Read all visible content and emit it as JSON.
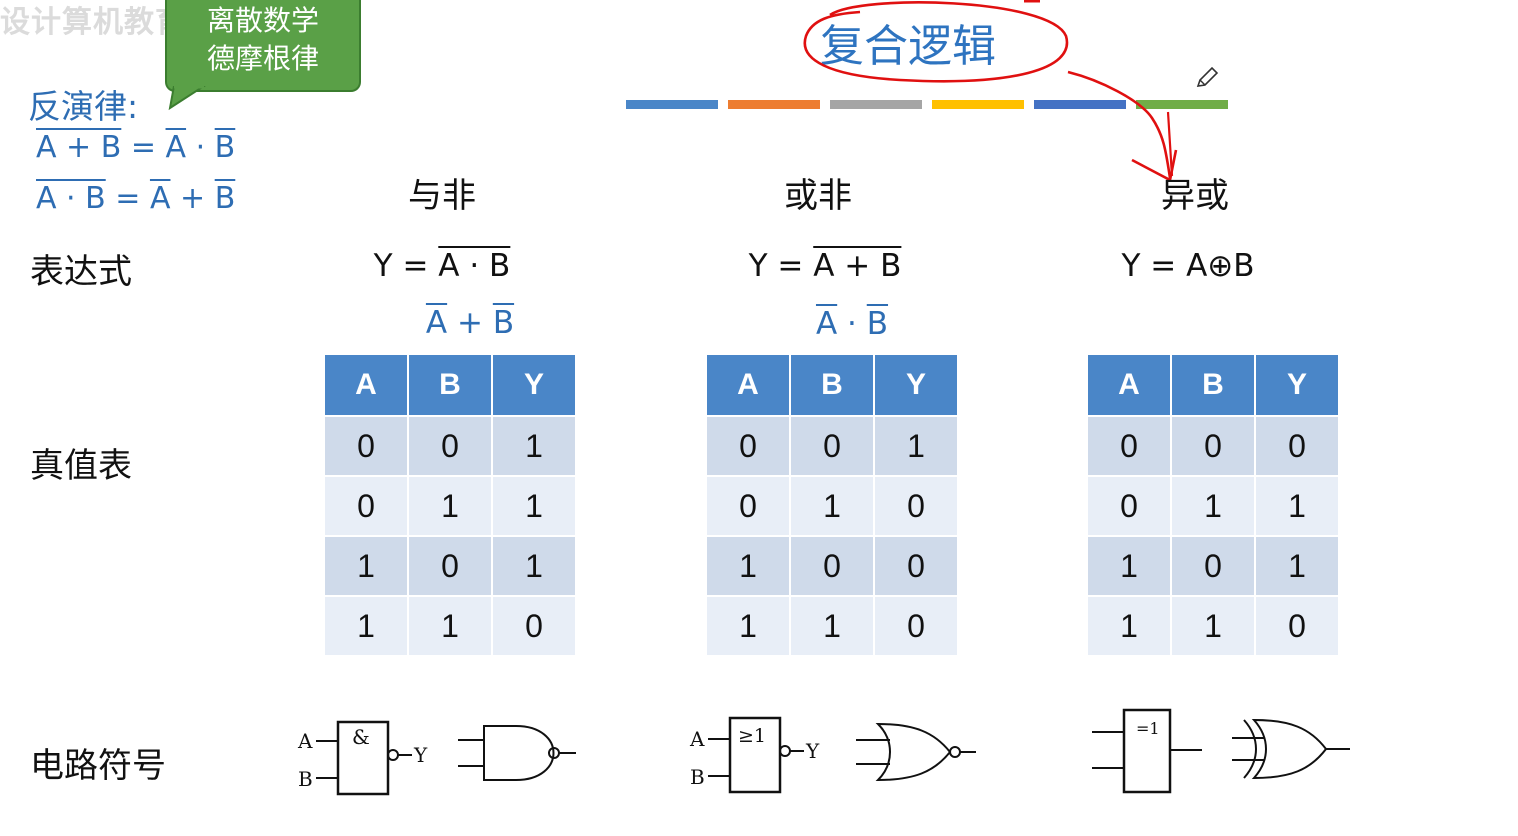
{
  "watermark": "设计算机教育",
  "callout": {
    "line1": "离散数学",
    "line2": "德摩根律"
  },
  "de_morgan": {
    "title": "反演律:",
    "law1": {
      "lhs": "A + B",
      "eq": " = ",
      "a": "A",
      "op": " · ",
      "b": "B"
    },
    "law2": {
      "lhs": "A · B",
      "eq": " = ",
      "a": "A",
      "op": " + ",
      "b": "B"
    }
  },
  "title": "复合逻辑",
  "color_bars": [
    "#4a86c8",
    "#ed7d31",
    "#a5a5a5",
    "#ffc000",
    "#4472c4",
    "#70ad47"
  ],
  "row_labels": {
    "expression": "表达式",
    "truth_table": "真值表",
    "symbol": "电路符号"
  },
  "columns": [
    {
      "name": "与非",
      "expr_prefix": "Y = ",
      "expr_bar": "A · B",
      "expr_plain": "",
      "alt": {
        "a": "A",
        "op": " + ",
        "b": "B"
      },
      "headers": [
        "A",
        "B",
        "Y"
      ],
      "rows": [
        [
          "0",
          "0",
          "1"
        ],
        [
          "0",
          "1",
          "1"
        ],
        [
          "1",
          "0",
          "1"
        ],
        [
          "1",
          "1",
          "0"
        ]
      ],
      "symbol_text": {
        "a": "A",
        "b": "B",
        "y": "Y",
        "gate": "&"
      }
    },
    {
      "name": "或非",
      "expr_prefix": "Y = ",
      "expr_bar": "A + B",
      "expr_plain": "",
      "alt": {
        "a": "A",
        "op": " · ",
        "b": "B"
      },
      "headers": [
        "A",
        "B",
        "Y"
      ],
      "rows": [
        [
          "0",
          "0",
          "1"
        ],
        [
          "0",
          "1",
          "0"
        ],
        [
          "1",
          "0",
          "0"
        ],
        [
          "1",
          "1",
          "0"
        ]
      ],
      "symbol_text": {
        "a": "A",
        "b": "B",
        "y": "Y",
        "gate": "≥1"
      }
    },
    {
      "name": "异或",
      "expr_prefix": "",
      "expr_bar": "",
      "expr_plain": "Y = A⊕B",
      "alt": {
        "a": "",
        "op": "",
        "b": ""
      },
      "headers": [
        "A",
        "B",
        "Y"
      ],
      "rows": [
        [
          "0",
          "0",
          "0"
        ],
        [
          "0",
          "1",
          "1"
        ],
        [
          "1",
          "0",
          "1"
        ],
        [
          "1",
          "1",
          "0"
        ]
      ],
      "symbol_text": {
        "gate": "=1"
      }
    }
  ],
  "annotation_color": "#e01010"
}
